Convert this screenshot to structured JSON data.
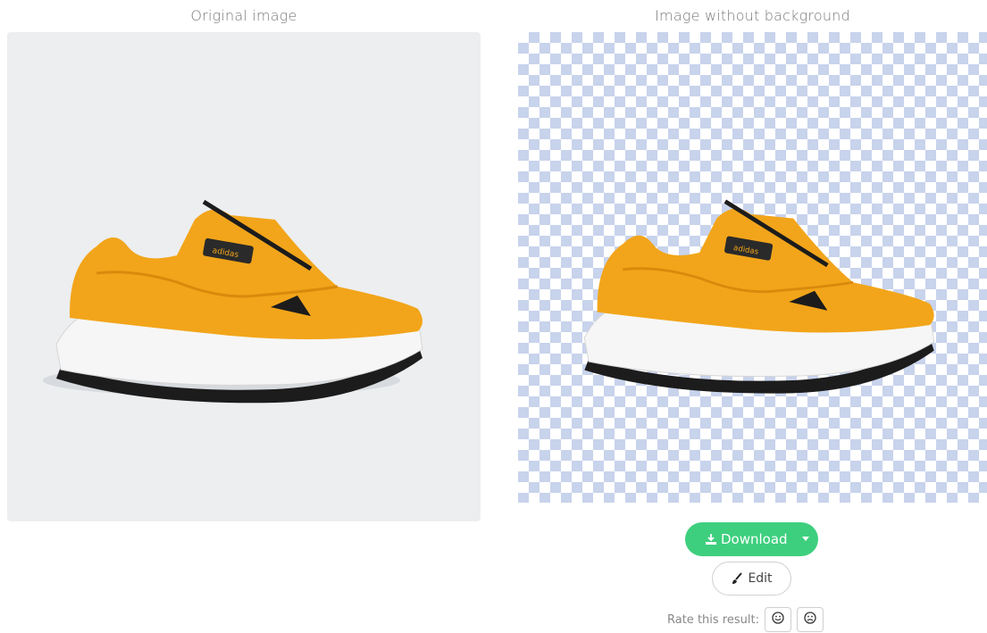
{
  "columns": {
    "left_title": "Original image",
    "right_title": "Image without background"
  },
  "images": {
    "original": {
      "icon": "sneaker-image",
      "brand_text": "adidas"
    },
    "processed": {
      "icon": "sneaker-image",
      "brand_text": "adidas"
    }
  },
  "actions": {
    "download_label": "Download",
    "edit_label": "Edit",
    "rate_label": "Rate this result:"
  },
  "colors": {
    "download_bg": "#3ecf7e",
    "checker": "#c8d3ec",
    "shoe_orange": "#f2a51a"
  }
}
